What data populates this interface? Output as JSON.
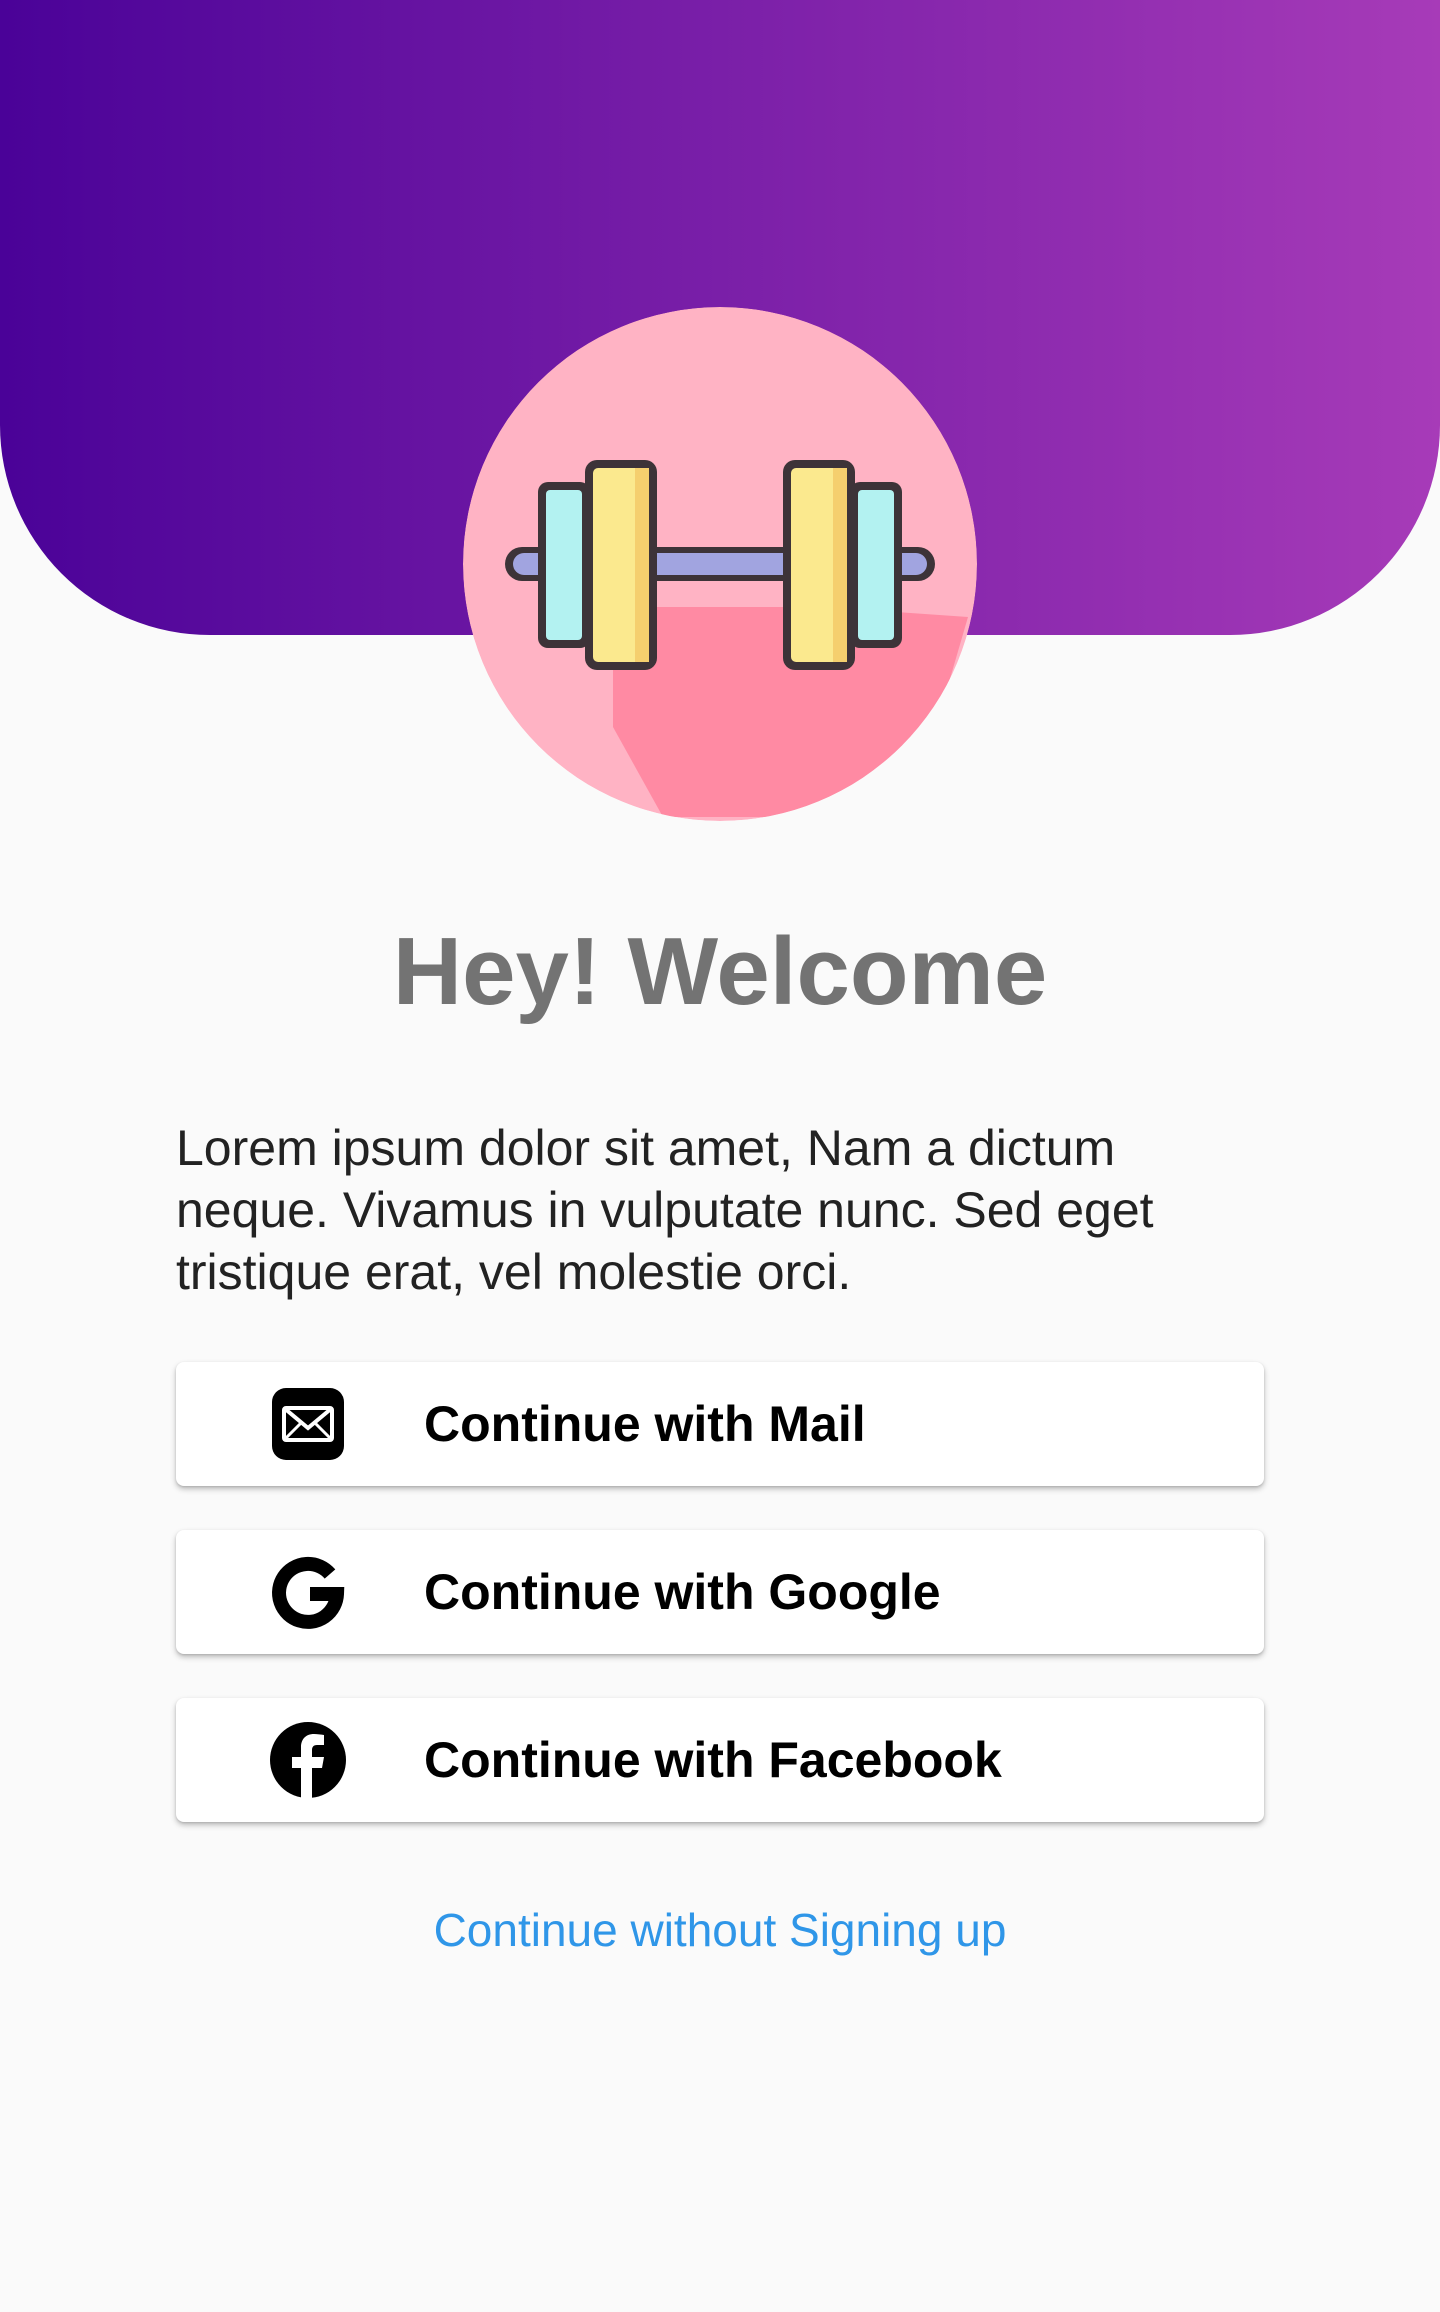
{
  "header": {
    "gradient_colors": [
      "#4a0298",
      "#7a1fa8",
      "#a73bb8"
    ],
    "logo_icon": "dumbbell-icon"
  },
  "welcome": {
    "title": "Hey! Welcome",
    "description": "Lorem ipsum dolor sit amet,  Nam a dictum neque. Vivamus in vulputate nunc. Sed eget tristique erat, vel molestie orci."
  },
  "buttons": [
    {
      "label": "Continue with Mail",
      "icon": "mail-icon"
    },
    {
      "label": "Continue with Google",
      "icon": "google-icon"
    },
    {
      "label": "Continue with Facebook",
      "icon": "facebook-icon"
    }
  ],
  "skip": {
    "label": "Continue without Signing up",
    "color": "#2f96e8"
  },
  "colors": {
    "background": "#fafafa",
    "title": "#737373",
    "logo_circle": "#ffb3c4"
  }
}
